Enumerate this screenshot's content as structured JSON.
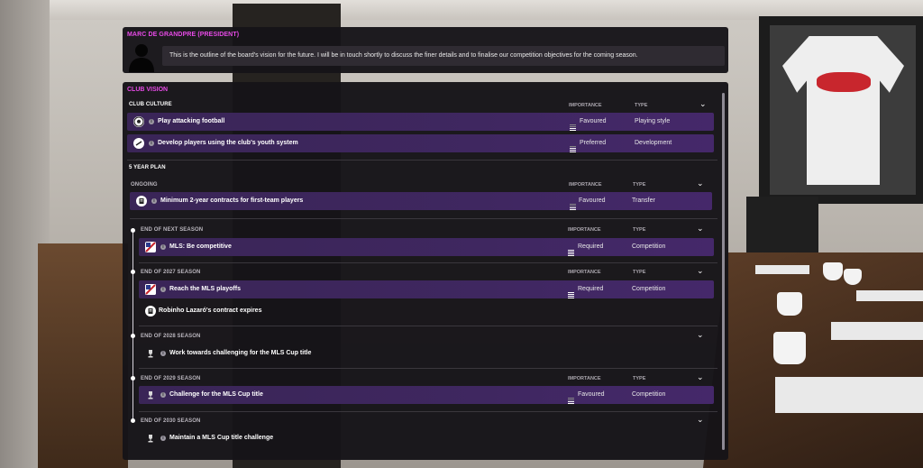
{
  "header": {
    "speaker": "MARC DE GRANDPRE (PRESIDENT)",
    "message": "This is the outline of the board's vision for the future. I will be in touch shortly to discuss the finer details and to finalise our competition objectives for the coming season."
  },
  "panel": {
    "title": "CLUB VISION",
    "club_culture": {
      "title": "CLUB CULTURE",
      "importance_head": "IMPORTANCE",
      "type_head": "TYPE",
      "rows": [
        {
          "label": "Play attacking football",
          "importance": "Favoured",
          "type": "Playing style",
          "icon": "football-icon"
        },
        {
          "label": "Develop players using the club's youth system",
          "importance": "Preferred",
          "type": "Development",
          "icon": "youth-development-icon"
        }
      ]
    },
    "five_year_plan": {
      "title": "5 YEAR PLAN",
      "ongoing": {
        "title": "ONGOING",
        "importance_head": "IMPORTANCE",
        "type_head": "TYPE",
        "rows": [
          {
            "label": "Minimum 2-year contracts for first-team players",
            "importance": "Favoured",
            "type": "Transfer",
            "icon": "contract-icon"
          }
        ]
      },
      "end_next_season": {
        "title": "END OF NEXT SEASON",
        "importance_head": "IMPORTANCE",
        "type_head": "TYPE",
        "rows": [
          {
            "label": "MLS: Be competitive",
            "importance": "Required",
            "type": "Competition",
            "icon": "mls-logo-icon"
          }
        ]
      },
      "end_2027": {
        "title": "END OF 2027 SEASON",
        "importance_head": "IMPORTANCE",
        "type_head": "TYPE",
        "rows": [
          {
            "label": "Reach the MLS playoffs",
            "importance": "Required",
            "type": "Competition",
            "icon": "mls-logo-icon"
          },
          {
            "label": "Robinho Lazaró's contract expires",
            "icon": "contract-icon"
          }
        ]
      },
      "end_2028": {
        "title": "END OF 2028 SEASON",
        "rows": [
          {
            "label": "Work towards challenging for the MLS Cup title",
            "icon": "trophy-icon"
          }
        ]
      },
      "end_2029": {
        "title": "END OF 2029 SEASON",
        "importance_head": "IMPORTANCE",
        "type_head": "TYPE",
        "rows": [
          {
            "label": "Challenge for the MLS Cup title",
            "importance": "Favoured",
            "type": "Competition",
            "icon": "trophy-icon"
          }
        ]
      },
      "end_2030": {
        "title": "END OF 2030 SEASON",
        "rows": [
          {
            "label": "Maintain a MLS Cup title challenge",
            "icon": "trophy-icon"
          }
        ]
      }
    }
  },
  "colors": {
    "accent": "#e64ae6",
    "row_purple": "#3f2760",
    "panel_bg": "#161418"
  }
}
